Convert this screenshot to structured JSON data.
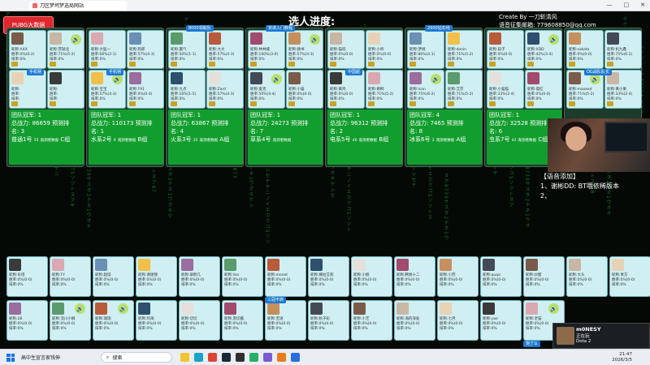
{
  "browser": {
    "tab_title": "刀区梦坷梦选局网站",
    "minimize": "—",
    "maximize": "□",
    "close": "✕"
  },
  "stage": {
    "title": "选人进度:",
    "pubg_button": "PUBG大数据",
    "creator_line1": "Create By 一刀斩清风",
    "creator_line2": "语音征集邮箱: 779608850@qq.com"
  },
  "labels": {
    "nick": "昵称:",
    "win": "胜率:",
    "loss": "排率:",
    "team_champion": "团队冠军:",
    "total_power": "总战力:",
    "predicted_rank": "预测排",
    "name": "名:",
    "spectrum": "观测者数据"
  },
  "groups": [
    {
      "tag": "",
      "tag2": "手机柄",
      "top_cards": [
        {
          "nick": "AXX",
          "win": "0%(0-2)",
          "rank": "0%"
        },
        {
          "nick": "苏轼北",
          "win": "71%(5-2)",
          "rank": "0%"
        }
      ],
      "mid_cards": [
        {
          "nick": "",
          "win": "",
          "rank": ""
        },
        {
          "nick": "",
          "win": "",
          "rank": ""
        }
      ],
      "champ": "1",
      "power": "86659",
      "rank": "3",
      "team": "普通1号",
      "rating": "55",
      "group": "C组"
    },
    {
      "tag": "",
      "tag2": "手机柄",
      "top_cards": [
        {
          "nick": "大猛一",
          "win": "66%(2-1)",
          "rank": "0%"
        },
        {
          "nick": "狗郎",
          "win": "57%(4-3)",
          "rank": "0%"
        }
      ],
      "mid_cards": [
        {
          "nick": "宝宝",
          "win": "57%(4-3)",
          "rank": "0%"
        },
        {
          "nick": "F91",
          "win": "0%(0-0)",
          "rank": "0%"
        }
      ],
      "champ": "1",
      "power": "110173",
      "rank": "1",
      "team": "水系2号",
      "rating": "9",
      "group": "B组"
    },
    {
      "tag": "8000领取队",
      "tag2": "",
      "top_cards": [
        {
          "nick": "赢气",
          "win": "50%(1-1)",
          "rank": "0%"
        },
        {
          "nick": "大大",
          "win": "57%(4-3)",
          "rank": "0%"
        }
      ],
      "mid_cards": [
        {
          "nick": "九点",
          "win": "16%(1-5)",
          "rank": "0%"
        },
        {
          "nick": "Zard",
          "win": "57%(4-3)",
          "rank": "0%"
        }
      ],
      "champ": "1",
      "power": "63867",
      "rank": "4",
      "team": "火系3号",
      "rating": "35",
      "group": "A组"
    },
    {
      "tag": "安卓入门教程",
      "tag2": "",
      "top_cards": [
        {
          "nick": "林林楠",
          "win": "100%(3-0)",
          "rank": "0%"
        },
        {
          "nick": "赫书",
          "win": "57%(4-3)",
          "rank": "0%"
        }
      ],
      "mid_cards": [
        {
          "nick": "麦克",
          "win": "50%(4-4)",
          "rank": "0%"
        },
        {
          "nick": "小猫",
          "win": "0%(0-0)",
          "rank": "0%"
        }
      ],
      "champ": "1",
      "power": "24273",
      "rank": "7",
      "team": "草系4号",
      "rating": "",
      "group": ""
    },
    {
      "tag": "",
      "tag2": "中国超",
      "top_cards": [
        {
          "nick": "猫咬",
          "win": "0%(0-0)",
          "rank": "0%"
        },
        {
          "nick": "小听",
          "win": "0%(0-0)",
          "rank": "0%"
        }
      ],
      "mid_cards": [
        {
          "nick": "黄鸡",
          "win": "0%(0-0)",
          "rank": "0%"
        },
        {
          "nick": "柳柳",
          "win": "71%(5-2)",
          "rank": "0%"
        }
      ],
      "champ": "1",
      "power": "96312",
      "rank": "2",
      "team": "电系5号",
      "rating": "46",
      "group": "B组"
    },
    {
      "tag": "2900钻石线",
      "tag2": "",
      "top_cards": [
        {
          "nick": "梦桃",
          "win": "80%(4-1)",
          "rank": "0%"
        },
        {
          "nick": "donin",
          "win": "71%(5-2)",
          "rank": "0%"
        }
      ],
      "mid_cards": [
        {
          "nick": "icon",
          "win": "75%(6-2)",
          "rank": "0%"
        },
        {
          "nick": "艾莎",
          "win": "71%(5-2)",
          "rank": "0%"
        }
      ],
      "champ": "4",
      "power": "7465",
      "rank": "8",
      "team": "冰系6号",
      "rating": "2",
      "group": "A组"
    },
    {
      "tag": "",
      "tag2": "",
      "top_cards": [
        {
          "nick": "段子",
          "win": "0%(0-0)",
          "rank": "0%"
        },
        {
          "nick": "XDD",
          "win": "42%(3-4)",
          "rank": "0%"
        }
      ],
      "mid_cards": [
        {
          "nick": "小猫猫",
          "win": "33%(2-4)",
          "rank": "0%"
        },
        {
          "nick": "孤红",
          "win": "0%(0-0)",
          "rank": "0%"
        }
      ],
      "champ": "1",
      "power": "32528",
      "rank": "6",
      "team": "虫系7号",
      "rating": "42",
      "group": "C组"
    },
    {
      "tag": "",
      "tag2": "OG战队队长",
      "top_cards": [
        {
          "nick": "sakata",
          "win": "0%(0-0)",
          "rank": "0%"
        },
        {
          "nick": "机九鑫",
          "win": "75%(6-2)",
          "rank": "0%"
        }
      ],
      "mid_cards": [
        {
          "nick": "maoxed",
          "win": "71%(5-2)",
          "rank": "0%"
        },
        {
          "nick": "黄小果",
          "win": "33%(2-4)",
          "rank": "0%"
        }
      ],
      "champ": "",
      "power": "",
      "rank": "",
      "team": "",
      "rating": "",
      "group": ""
    }
  ],
  "bottom_tags": {
    "t1": "三冠不肩",
    "t2": "饱了么"
  },
  "bottom_row1": [
    {
      "nick": "乐瑶",
      "win": "0%(0-0)",
      "rank": "0%"
    },
    {
      "nick": "FY",
      "win": "0%(0-0)",
      "rank": "0%"
    },
    {
      "nick": "超塔",
      "win": "0%(0-0)",
      "rank": "0%"
    },
    {
      "nick": "谢谢我",
      "win": "0%(0-0)",
      "rank": "0%"
    },
    {
      "nick": "翠鹤几",
      "win": "0%(0-0)",
      "rank": "0%"
    },
    {
      "nick": "lisa",
      "win": "0%(0-0)",
      "rank": "0%"
    },
    {
      "nick": "monet",
      "win": "0%(0-0)",
      "rank": "0%"
    },
    {
      "nick": "横拉艾莉",
      "win": "0%(0-0)",
      "rank": "0%"
    },
    {
      "nick": "小鹅",
      "win": "0%(0-0)",
      "rank": "0%"
    },
    {
      "nick": "腾易十二",
      "win": "0%(0-0)",
      "rank": "0%"
    },
    {
      "nick": "小苏",
      "win": "0%(0-0)",
      "rank": "0%"
    },
    {
      "nick": "quqo",
      "win": "0%(0-0)",
      "rank": "0%"
    },
    {
      "nick": "炒醋",
      "win": "0%(0-0)",
      "rank": "0%"
    },
    {
      "nick": "大头",
      "win": "0%(0-0)",
      "rank": "0%"
    },
    {
      "nick": "青方",
      "win": "0%(0-0)",
      "rank": "0%"
    }
  ],
  "bottom_row2": [
    {
      "nick": "28",
      "win": "0%(0-0)",
      "rank": "0%"
    },
    {
      "nick": "流川小枫",
      "win": "0%(0-0)",
      "rank": "0%"
    },
    {
      "nick": "瑞瑞",
      "win": "0%(0-0)",
      "rank": "0%"
    },
    {
      "nick": "阿海",
      "win": "0%(0-0)",
      "rank": "0%"
    },
    {
      "nick": "切切",
      "win": "0%(0-0)",
      "rank": "0%"
    },
    {
      "nick": "黑切酱",
      "win": "0%(0-0)",
      "rank": "0%"
    },
    {
      "nick": "无语",
      "win": "0%(0-0)",
      "rank": "0%"
    },
    {
      "nick": "秋子彩",
      "win": "0%(0-0)",
      "rank": "0%"
    },
    {
      "nick": "小艺",
      "win": "0%(0-0)",
      "rank": "0%"
    },
    {
      "nick": "海的深处",
      "win": "0%(0-0)",
      "rank": "0%"
    },
    {
      "nick": "七月",
      "win": "0%(0-0)",
      "rank": "0%"
    },
    {
      "nick": "yao",
      "win": "0%(0-0)",
      "rank": "0%"
    },
    {
      "nick": "老猫",
      "win": "0%(0-0)",
      "rank": "0%"
    }
  ],
  "voice": {
    "title": "【语音添加】",
    "line1": "1、谢彬DD: BT哦依稀版本",
    "line2": "2、"
  },
  "game_widget": {
    "name": "m0NESY",
    "status": "正在玩",
    "game": "Dota 2"
  },
  "taskbar": {
    "weather": "高中生宣言家钱伸",
    "search": "搜索",
    "time": "21:47",
    "date": "2026/3/5"
  },
  "colors": {
    "card_bg": "#cfeff3",
    "info_green": "#129e2e",
    "tag_blue": "#1e7ad1",
    "pubg_red": "#e0262e",
    "rain_green": "#2db34a"
  }
}
